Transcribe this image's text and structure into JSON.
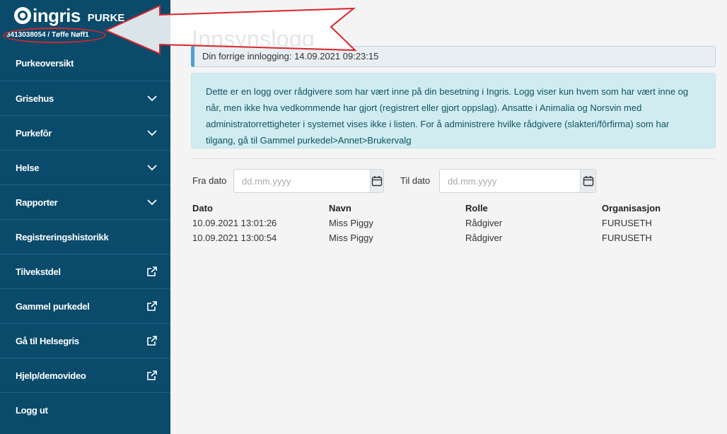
{
  "brand": {
    "name": "ingris",
    "product": "PURKE",
    "user_id": "3413038054 / Tøffe Nøff1"
  },
  "sidebar": {
    "items": [
      {
        "label": "Purkeoversikt",
        "icon": ""
      },
      {
        "label": "Grisehus",
        "icon": "chevron-down-icon"
      },
      {
        "label": "Purkefôr",
        "icon": "chevron-down-icon"
      },
      {
        "label": "Helse",
        "icon": "chevron-down-icon"
      },
      {
        "label": "Rapporter",
        "icon": "chevron-down-icon"
      },
      {
        "label": "Registreringshistorikk",
        "icon": ""
      },
      {
        "label": "Tilvekstdel",
        "icon": "external-link-icon"
      },
      {
        "label": "Gammel purkedel",
        "icon": "external-link-icon"
      },
      {
        "label": "Gå til Helsegris",
        "icon": "external-link-icon"
      },
      {
        "label": "Hjelp/demovideo",
        "icon": "external-link-icon"
      },
      {
        "label": "Logg ut",
        "icon": ""
      }
    ]
  },
  "main": {
    "title": "Innsynslogg",
    "last_login": "Din forrige innlogging: 14.09.2021 09:23:15",
    "info_text": "Dette er en logg over rådgivere som har vært inne på din besetning i Ingris. Logg viser kun hvem som har vært inne og når, men ikke hva vedkommende har gjort (registrert eller gjort oppslag). Ansatte i Animalia og Norsvin med administratorrettigheter i systemet vises ikke i listen. For å administrere hvilke rådgivere (slakteri/fôrfirma) som har tilgang, gå til Gammel purkedel>Annet>Brukervalg",
    "filters": {
      "from_label": "Fra dato",
      "from_placeholder": "dd.mm.yyyy",
      "to_label": "Til dato",
      "to_placeholder": "dd.mm.yyyy"
    },
    "table": {
      "headers": [
        "Dato",
        "Navn",
        "Rolle",
        "Organisasjon"
      ],
      "rows": [
        [
          "10.09.2021 13:01:26",
          "Miss Piggy",
          "Rådgiver",
          "FURUSETH"
        ],
        [
          "10.09.2021 13:00:54",
          "Miss Piggy",
          "Rådgiver",
          "FURUSETH"
        ]
      ]
    }
  },
  "colors": {
    "sidebar": "#0a4a6b",
    "annotation": "#d9262c",
    "info_bg": "#d1ecf1"
  }
}
